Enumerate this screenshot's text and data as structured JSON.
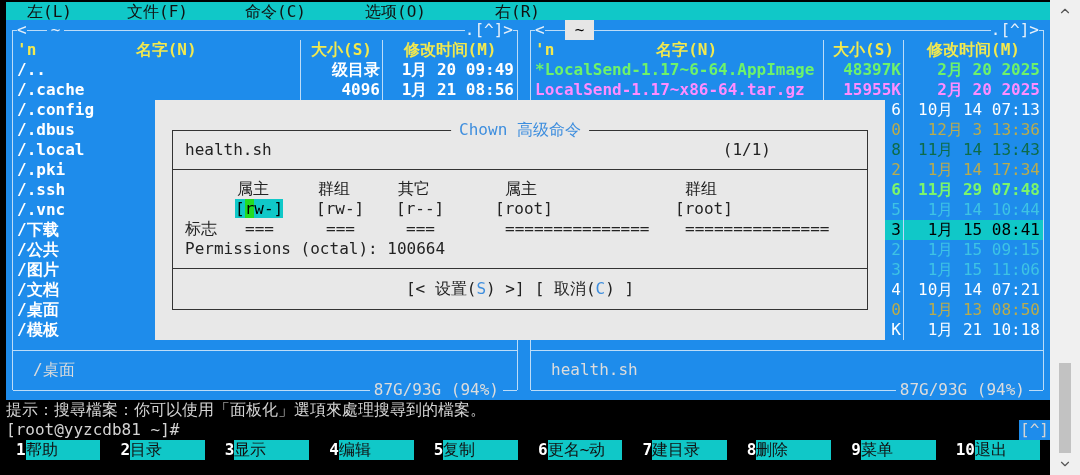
{
  "menu_bar": [
    "左(L)",
    "文件(F)",
    "命令(C)",
    "选项(O)",
    "右(R)"
  ],
  "left_panel": {
    "active": false,
    "history_button": "<",
    "path": "~",
    "scroll_marker": ".[^]>",
    "columns": {
      "mark": "'n",
      "name": "名字(N)",
      "size": "大小(S)",
      "time": "修改时间(M)"
    },
    "rows": [
      {
        "name": "/..",
        "size": "级目录",
        "time": "1月 20 09:49",
        "color": "#ffffff",
        "bold": true,
        "selected": false
      },
      {
        "name": "/.cache",
        "size": "4096",
        "time": "1月 21 08:56",
        "color": "#ffffff",
        "bold": true,
        "selected": false
      },
      {
        "name": "/.config",
        "color": "#ffffff",
        "bold": true,
        "selected": false
      },
      {
        "name": "/.dbus",
        "color": "#ffffff",
        "bold": true,
        "selected": false
      },
      {
        "name": "/.local",
        "color": "#ffffff",
        "bold": true,
        "selected": false
      },
      {
        "name": "/.pki",
        "color": "#ffffff",
        "bold": true,
        "selected": false
      },
      {
        "name": "/.ssh",
        "color": "#ffffff",
        "bold": true,
        "selected": false
      },
      {
        "name": "/.vnc",
        "color": "#ffffff",
        "bold": true,
        "selected": false
      },
      {
        "name": "/下载",
        "color": "#ffffff",
        "bold": true,
        "selected": false
      },
      {
        "name": "/公共",
        "color": "#ffffff",
        "bold": true,
        "selected": false
      },
      {
        "name": "/图片",
        "color": "#ffffff",
        "bold": true,
        "selected": false
      },
      {
        "name": "/文档",
        "color": "#ffffff",
        "bold": true,
        "selected": false
      },
      {
        "name": "/桌面",
        "color": "#ffffff",
        "bold": true,
        "selected": false
      },
      {
        "name": "/模板",
        "color": "#ffffff",
        "bold": true,
        "selected": false
      }
    ],
    "mini_status": "/桌面",
    "disk": "87G/93G (94%)"
  },
  "right_panel": {
    "active": true,
    "history_button": "<",
    "path": "~",
    "scroll_marker": ".[^]>",
    "columns": {
      "mark": "'n",
      "name": "名字(N)",
      "size": "大小(S)",
      "time": "修改时间(M)"
    },
    "rows": [
      {
        "name": "*LocalSend-1.17~6-64.AppImage",
        "size": "48397K",
        "time": "2月 20 2025",
        "color": "#6ef26a",
        "bold": true,
        "selected": false
      },
      {
        "name": "LocalSend-1.17~x86-64.tar.gz",
        "size": "15955K",
        "time": "2月 20 2025",
        "color": "#ff8cff",
        "bold": true,
        "selected": false
      },
      {
        "size": "6",
        "time": "10月 14 07:13",
        "color": "#ffffff",
        "bold": false,
        "selected": false
      },
      {
        "size": "0",
        "time": "12月 3 13:36",
        "color": "#b9ac4e",
        "bold": false,
        "selected": false
      },
      {
        "size": "8",
        "time": "11月 14 13:43",
        "color": "#0e6b48",
        "bold": false,
        "selected": false
      },
      {
        "size": "2",
        "time": "1月 14 17:34",
        "color": "#b9ac4e",
        "bold": false,
        "selected": false
      },
      {
        "size": "6",
        "time": "11月 29 07:48",
        "color": "#7cf56b",
        "bold": true,
        "selected": false
      },
      {
        "size": "5",
        "time": "1月 14 10:44",
        "color": "#3ec3e4",
        "bold": false,
        "selected": false
      },
      {
        "size": "3",
        "time": "1月 15 08:41",
        "bold": false,
        "selected": true
      },
      {
        "size": "2",
        "time": "1月 15 09:15",
        "color": "#3ec3e4",
        "bold": false,
        "selected": false
      },
      {
        "size": "3",
        "time": "1月 15 11:06",
        "color": "#3ec3e4",
        "bold": false,
        "selected": false
      },
      {
        "size": "4",
        "time": "10月 14 07:21",
        "color": "#ffffff",
        "bold": false,
        "selected": false
      },
      {
        "size": "0",
        "time": "1月 13 08:50",
        "color": "#b9ac4e",
        "bold": false,
        "selected": false
      },
      {
        "size": "K",
        "time": "1月 21 10:18",
        "color": "#ffffff",
        "bold": false,
        "selected": false
      }
    ],
    "mini_status": "health.sh",
    "disk": "87G/93G (94%)"
  },
  "dialog": {
    "title": "Chown 高级命令",
    "file": "health.sh",
    "counter": "(1/1)",
    "flags_label": "标志",
    "fields": [
      {
        "label": "属主",
        "value": "[rw-]",
        "flags": "===",
        "selected": true
      },
      {
        "label": "群组",
        "value": "[rw-]",
        "flags": "===",
        "selected": false
      },
      {
        "label": "其它",
        "value": "[r--]",
        "flags": "===",
        "selected": false
      },
      {
        "label": "属主",
        "value": "[root]",
        "flags": "===============",
        "selected": false
      },
      {
        "label": "群组",
        "value": "[root]",
        "flags": "===============",
        "selected": false
      }
    ],
    "permissions": "Permissions (octal): 100664",
    "buttons": [
      {
        "before": "[< 设置(",
        "hotkey": "S",
        "after": ") >]"
      },
      {
        "before": "[ 取消(",
        "hotkey": "C",
        "after": ") ]"
      }
    ]
  },
  "hint": "提示：搜尋檔案：你可以使用「面板化」選項來處理搜尋到的檔案。",
  "prompt": "[root@yyzcdb81 ~]#",
  "prompt_marker": "[^]",
  "function_keys": [
    {
      "number": "1",
      "label": "帮助"
    },
    {
      "number": "2",
      "label": "目录"
    },
    {
      "number": "3",
      "label": "显示"
    },
    {
      "number": "4",
      "label": "编辑"
    },
    {
      "number": "5",
      "label": "复制"
    },
    {
      "number": "6",
      "label": "更名~动"
    },
    {
      "number": "7",
      "label": "建目录"
    },
    {
      "number": "8",
      "label": "删除"
    },
    {
      "number": "9",
      "label": "菜单"
    },
    {
      "number": "10",
      "label": "退出"
    }
  ]
}
